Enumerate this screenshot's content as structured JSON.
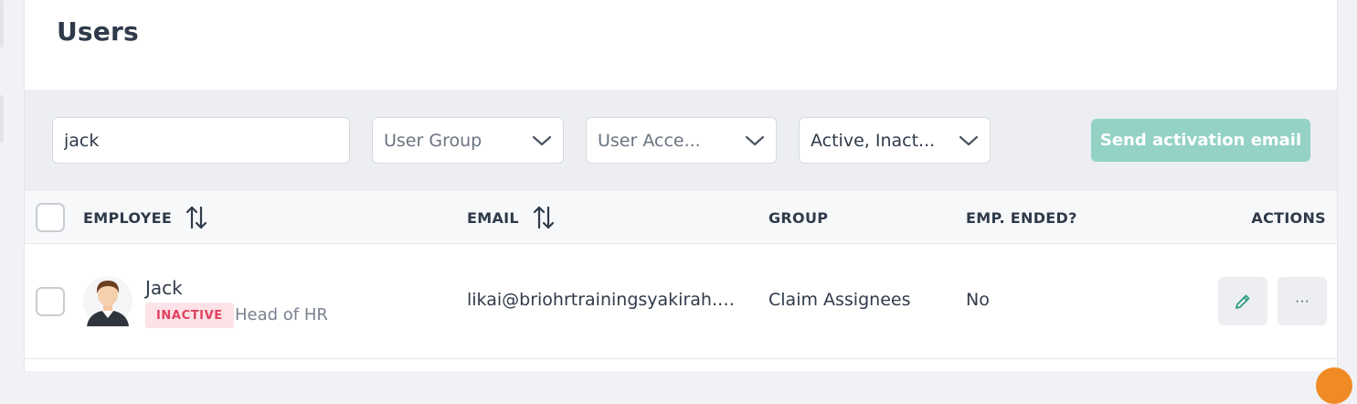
{
  "page": {
    "title": "Users"
  },
  "filters": {
    "search_value": "jack",
    "user_group": "User Group",
    "user_access": "User Acce...",
    "status": "Active, Inact...",
    "send_activation_label": "Send activation email"
  },
  "table": {
    "headers": {
      "employee": "EMPLOYEE",
      "email": "EMAIL",
      "group": "GROUP",
      "emp_ended": "EMP. ENDED?",
      "actions": "ACTIONS"
    },
    "rows": [
      {
        "name": "Jack",
        "status_badge": "INACTIVE",
        "job_title": "Head of HR",
        "email": "likai@briohrtrainingsyakirah.c...",
        "group": "Claim Assignees",
        "emp_ended": "No",
        "more_label": "···"
      }
    ]
  },
  "colors": {
    "accent_button": "#93d2c5",
    "badge_inactive_bg": "#fde2e7",
    "badge_inactive_text": "#e1415f",
    "filter_bar_bg": "#eceef1"
  },
  "icons": {
    "sort": "sort-arrows-icon",
    "chevron": "chevron-down-icon",
    "edit": "pencil-icon",
    "more": "more-horizontal-icon"
  }
}
